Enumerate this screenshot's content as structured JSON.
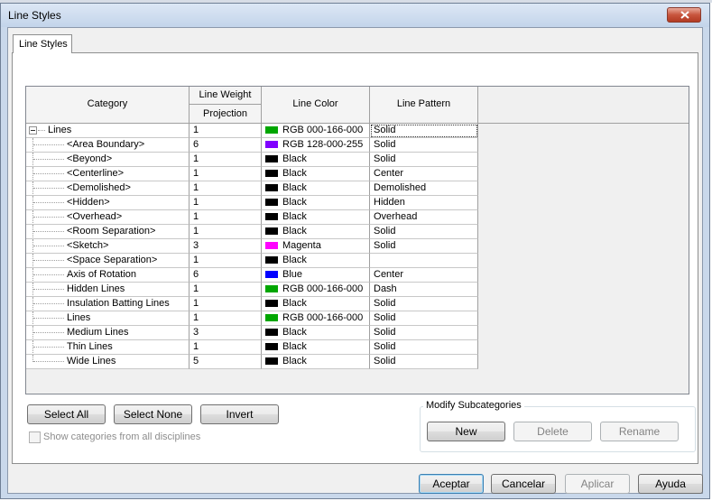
{
  "window": {
    "title": "Line Styles"
  },
  "tabs": [
    {
      "label": "Line Styles"
    }
  ],
  "table": {
    "headers": {
      "category": "Category",
      "line_weight": "Line Weight",
      "projection": "Projection",
      "line_color": "Line Color",
      "line_pattern": "Line Pattern"
    },
    "rows": [
      {
        "category": "Lines",
        "weight": "1",
        "color": "RGB 000-166-000",
        "swatch": "#00a600",
        "pattern": "Solid"
      },
      {
        "category": "<Area Boundary>",
        "weight": "6",
        "color": "RGB 128-000-255",
        "swatch": "#8000ff",
        "pattern": "Solid"
      },
      {
        "category": "<Beyond>",
        "weight": "1",
        "color": "Black",
        "swatch": "#000000",
        "pattern": "Solid"
      },
      {
        "category": "<Centerline>",
        "weight": "1",
        "color": "Black",
        "swatch": "#000000",
        "pattern": "Center"
      },
      {
        "category": "<Demolished>",
        "weight": "1",
        "color": "Black",
        "swatch": "#000000",
        "pattern": "Demolished"
      },
      {
        "category": "<Hidden>",
        "weight": "1",
        "color": "Black",
        "swatch": "#000000",
        "pattern": "Hidden"
      },
      {
        "category": "<Overhead>",
        "weight": "1",
        "color": "Black",
        "swatch": "#000000",
        "pattern": "Overhead"
      },
      {
        "category": "<Room Separation>",
        "weight": "1",
        "color": "Black",
        "swatch": "#000000",
        "pattern": "Solid"
      },
      {
        "category": "<Sketch>",
        "weight": "3",
        "color": "Magenta",
        "swatch": "#ff00ff",
        "pattern": "Solid"
      },
      {
        "category": "<Space Separation>",
        "weight": "1",
        "color": "Black",
        "swatch": "#000000",
        "pattern": ""
      },
      {
        "category": "Axis of Rotation",
        "weight": "6",
        "color": "Blue",
        "swatch": "#0000ff",
        "pattern": "Center"
      },
      {
        "category": "Hidden Lines",
        "weight": "1",
        "color": "RGB 000-166-000",
        "swatch": "#00a600",
        "pattern": "Dash"
      },
      {
        "category": "Insulation Batting Lines",
        "weight": "1",
        "color": "Black",
        "swatch": "#000000",
        "pattern": "Solid"
      },
      {
        "category": "Lines",
        "weight": "1",
        "color": "RGB 000-166-000",
        "swatch": "#00a600",
        "pattern": "Solid"
      },
      {
        "category": "Medium Lines",
        "weight": "3",
        "color": "Black",
        "swatch": "#000000",
        "pattern": "Solid"
      },
      {
        "category": "Thin Lines",
        "weight": "1",
        "color": "Black",
        "swatch": "#000000",
        "pattern": "Solid"
      },
      {
        "category": "Wide Lines",
        "weight": "5",
        "color": "Black",
        "swatch": "#000000",
        "pattern": "Solid"
      }
    ]
  },
  "selection_buttons": {
    "select_all": "Select All",
    "select_none": "Select None",
    "invert": "Invert"
  },
  "show_all_disciplines": {
    "label": "Show categories from all disciplines",
    "checked": false
  },
  "modify_subcategories": {
    "title": "Modify Subcategories",
    "new": "New",
    "delete": "Delete",
    "rename": "Rename"
  },
  "footer": {
    "ok": "Aceptar",
    "cancel": "Cancelar",
    "apply": "Aplicar",
    "help": "Ayuda"
  }
}
